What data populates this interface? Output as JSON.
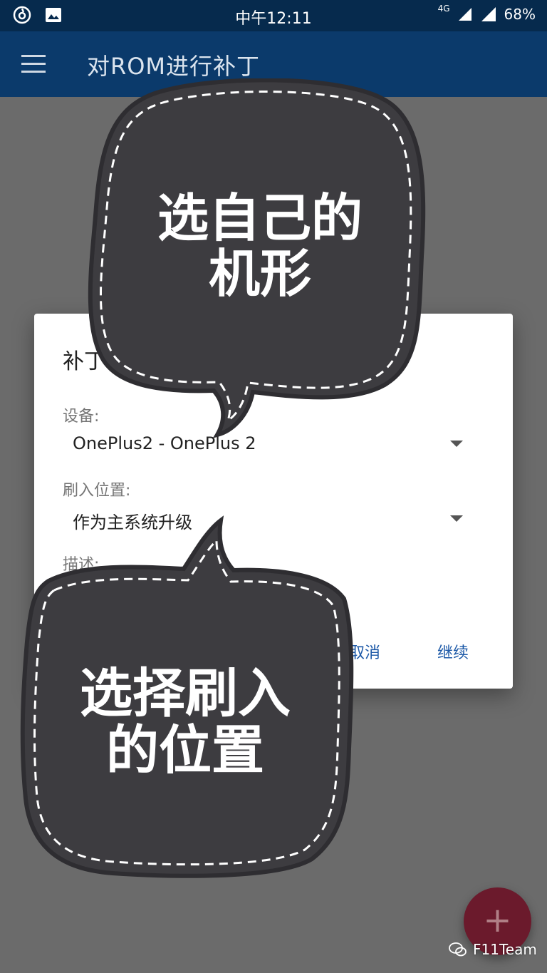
{
  "status_bar": {
    "time": "中午12:11",
    "network": "4G",
    "battery": "68%",
    "left_icons": [
      "netease-music-icon",
      "image-icon"
    ]
  },
  "app_bar": {
    "title": "对ROM进行补丁",
    "menu_icon": "hamburger-menu-icon"
  },
  "dialog": {
    "title": "补丁",
    "device_label": "设备:",
    "device_value": "OnePlus2 - OnePlus 2",
    "flash_location_label": "刷入位置:",
    "flash_location_value": "作为主系统升级",
    "description_label": "描述:",
    "cancel_label": "取消",
    "continue_label": "继续"
  },
  "callouts": {
    "top_line1": "选自己的",
    "top_line2": "机形",
    "bottom_line1": "选择刷入",
    "bottom_line2": "的位置"
  },
  "fab": {
    "label": "+"
  },
  "watermark": {
    "text": "F11Team"
  },
  "colors": {
    "status_bar": "#062a4d",
    "app_bar": "#0b3a6b",
    "scrim": "#6b6b6b",
    "accent": "#1e5aa8",
    "bubble_fill": "#3d3c40",
    "fab": "#6b1a2c"
  }
}
